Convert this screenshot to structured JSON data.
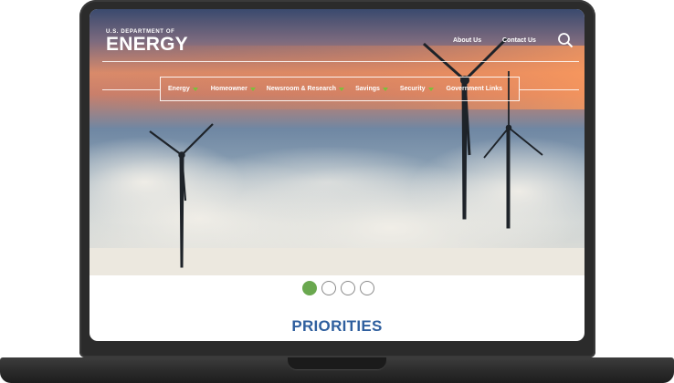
{
  "logo": {
    "line1": "U.S. DEPARTMENT OF",
    "line2": "ENERGY"
  },
  "top_links": {
    "about": "About Us",
    "contact": "Contact Us"
  },
  "nav": {
    "items": [
      {
        "label": "Energy",
        "has_caret": true
      },
      {
        "label": "Homeowner",
        "has_caret": true
      },
      {
        "label": "Newsroom & Research",
        "has_caret": true
      },
      {
        "label": "Savings",
        "has_caret": true
      },
      {
        "label": "Security",
        "has_caret": true
      },
      {
        "label": "Government Links",
        "has_caret": false
      }
    ],
    "caret_color": "#7bbf3a"
  },
  "carousel": {
    "slide_count": 4,
    "active_index": 0,
    "active_color": "#6aa84f"
  },
  "section": {
    "heading": "PRIORITIES",
    "heading_color": "#2f5f9e"
  },
  "icons": {
    "search": "search-icon"
  }
}
